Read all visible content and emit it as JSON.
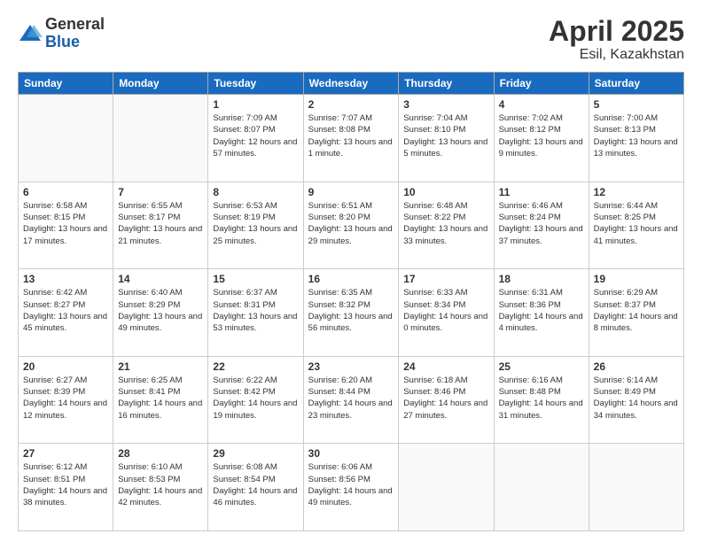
{
  "logo": {
    "general": "General",
    "blue": "Blue"
  },
  "header": {
    "title": "April 2025",
    "subtitle": "Esil, Kazakhstan"
  },
  "weekdays": [
    "Sunday",
    "Monday",
    "Tuesday",
    "Wednesday",
    "Thursday",
    "Friday",
    "Saturday"
  ],
  "weeks": [
    [
      {
        "day": null
      },
      {
        "day": null
      },
      {
        "day": "1",
        "sunrise": "Sunrise: 7:09 AM",
        "sunset": "Sunset: 8:07 PM",
        "daylight": "Daylight: 12 hours and 57 minutes."
      },
      {
        "day": "2",
        "sunrise": "Sunrise: 7:07 AM",
        "sunset": "Sunset: 8:08 PM",
        "daylight": "Daylight: 13 hours and 1 minute."
      },
      {
        "day": "3",
        "sunrise": "Sunrise: 7:04 AM",
        "sunset": "Sunset: 8:10 PM",
        "daylight": "Daylight: 13 hours and 5 minutes."
      },
      {
        "day": "4",
        "sunrise": "Sunrise: 7:02 AM",
        "sunset": "Sunset: 8:12 PM",
        "daylight": "Daylight: 13 hours and 9 minutes."
      },
      {
        "day": "5",
        "sunrise": "Sunrise: 7:00 AM",
        "sunset": "Sunset: 8:13 PM",
        "daylight": "Daylight: 13 hours and 13 minutes."
      }
    ],
    [
      {
        "day": "6",
        "sunrise": "Sunrise: 6:58 AM",
        "sunset": "Sunset: 8:15 PM",
        "daylight": "Daylight: 13 hours and 17 minutes."
      },
      {
        "day": "7",
        "sunrise": "Sunrise: 6:55 AM",
        "sunset": "Sunset: 8:17 PM",
        "daylight": "Daylight: 13 hours and 21 minutes."
      },
      {
        "day": "8",
        "sunrise": "Sunrise: 6:53 AM",
        "sunset": "Sunset: 8:19 PM",
        "daylight": "Daylight: 13 hours and 25 minutes."
      },
      {
        "day": "9",
        "sunrise": "Sunrise: 6:51 AM",
        "sunset": "Sunset: 8:20 PM",
        "daylight": "Daylight: 13 hours and 29 minutes."
      },
      {
        "day": "10",
        "sunrise": "Sunrise: 6:48 AM",
        "sunset": "Sunset: 8:22 PM",
        "daylight": "Daylight: 13 hours and 33 minutes."
      },
      {
        "day": "11",
        "sunrise": "Sunrise: 6:46 AM",
        "sunset": "Sunset: 8:24 PM",
        "daylight": "Daylight: 13 hours and 37 minutes."
      },
      {
        "day": "12",
        "sunrise": "Sunrise: 6:44 AM",
        "sunset": "Sunset: 8:25 PM",
        "daylight": "Daylight: 13 hours and 41 minutes."
      }
    ],
    [
      {
        "day": "13",
        "sunrise": "Sunrise: 6:42 AM",
        "sunset": "Sunset: 8:27 PM",
        "daylight": "Daylight: 13 hours and 45 minutes."
      },
      {
        "day": "14",
        "sunrise": "Sunrise: 6:40 AM",
        "sunset": "Sunset: 8:29 PM",
        "daylight": "Daylight: 13 hours and 49 minutes."
      },
      {
        "day": "15",
        "sunrise": "Sunrise: 6:37 AM",
        "sunset": "Sunset: 8:31 PM",
        "daylight": "Daylight: 13 hours and 53 minutes."
      },
      {
        "day": "16",
        "sunrise": "Sunrise: 6:35 AM",
        "sunset": "Sunset: 8:32 PM",
        "daylight": "Daylight: 13 hours and 56 minutes."
      },
      {
        "day": "17",
        "sunrise": "Sunrise: 6:33 AM",
        "sunset": "Sunset: 8:34 PM",
        "daylight": "Daylight: 14 hours and 0 minutes."
      },
      {
        "day": "18",
        "sunrise": "Sunrise: 6:31 AM",
        "sunset": "Sunset: 8:36 PM",
        "daylight": "Daylight: 14 hours and 4 minutes."
      },
      {
        "day": "19",
        "sunrise": "Sunrise: 6:29 AM",
        "sunset": "Sunset: 8:37 PM",
        "daylight": "Daylight: 14 hours and 8 minutes."
      }
    ],
    [
      {
        "day": "20",
        "sunrise": "Sunrise: 6:27 AM",
        "sunset": "Sunset: 8:39 PM",
        "daylight": "Daylight: 14 hours and 12 minutes."
      },
      {
        "day": "21",
        "sunrise": "Sunrise: 6:25 AM",
        "sunset": "Sunset: 8:41 PM",
        "daylight": "Daylight: 14 hours and 16 minutes."
      },
      {
        "day": "22",
        "sunrise": "Sunrise: 6:22 AM",
        "sunset": "Sunset: 8:42 PM",
        "daylight": "Daylight: 14 hours and 19 minutes."
      },
      {
        "day": "23",
        "sunrise": "Sunrise: 6:20 AM",
        "sunset": "Sunset: 8:44 PM",
        "daylight": "Daylight: 14 hours and 23 minutes."
      },
      {
        "day": "24",
        "sunrise": "Sunrise: 6:18 AM",
        "sunset": "Sunset: 8:46 PM",
        "daylight": "Daylight: 14 hours and 27 minutes."
      },
      {
        "day": "25",
        "sunrise": "Sunrise: 6:16 AM",
        "sunset": "Sunset: 8:48 PM",
        "daylight": "Daylight: 14 hours and 31 minutes."
      },
      {
        "day": "26",
        "sunrise": "Sunrise: 6:14 AM",
        "sunset": "Sunset: 8:49 PM",
        "daylight": "Daylight: 14 hours and 34 minutes."
      }
    ],
    [
      {
        "day": "27",
        "sunrise": "Sunrise: 6:12 AM",
        "sunset": "Sunset: 8:51 PM",
        "daylight": "Daylight: 14 hours and 38 minutes."
      },
      {
        "day": "28",
        "sunrise": "Sunrise: 6:10 AM",
        "sunset": "Sunset: 8:53 PM",
        "daylight": "Daylight: 14 hours and 42 minutes."
      },
      {
        "day": "29",
        "sunrise": "Sunrise: 6:08 AM",
        "sunset": "Sunset: 8:54 PM",
        "daylight": "Daylight: 14 hours and 46 minutes."
      },
      {
        "day": "30",
        "sunrise": "Sunrise: 6:06 AM",
        "sunset": "Sunset: 8:56 PM",
        "daylight": "Daylight: 14 hours and 49 minutes."
      },
      {
        "day": null
      },
      {
        "day": null
      },
      {
        "day": null
      }
    ]
  ]
}
